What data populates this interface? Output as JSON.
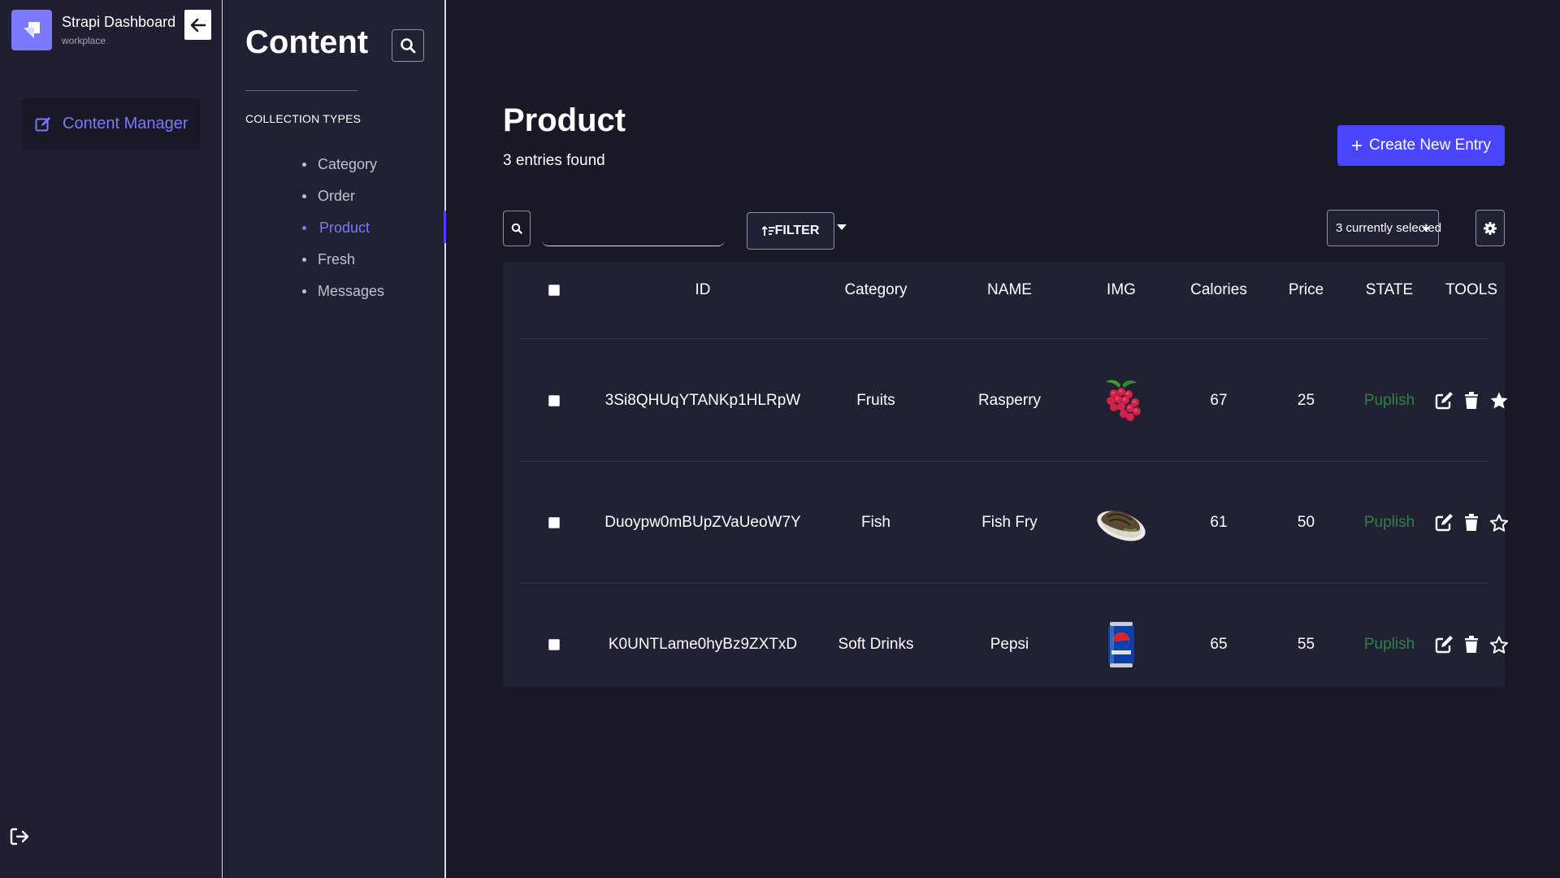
{
  "brand": {
    "title": "Strapi Dashboard",
    "subtitle": "workplace"
  },
  "leftnav": {
    "content_manager_label": "Content Manager"
  },
  "subnav": {
    "title": "Content",
    "section_title": "COLLECTION TYPES",
    "items": [
      {
        "label": "Category",
        "active": false
      },
      {
        "label": "Order",
        "active": false
      },
      {
        "label": "Product",
        "active": true
      },
      {
        "label": "Fresh",
        "active": false
      },
      {
        "label": "Messages",
        "active": false
      }
    ]
  },
  "main": {
    "title": "Product",
    "entries_text": "3 entries found",
    "create_button_label": "Create New Entry",
    "search_value": "",
    "filter_label": "FILTER",
    "columns_selected": "3 currently selected"
  },
  "table": {
    "headers": {
      "id": "ID",
      "category": "Category",
      "name": "NAME",
      "img": "IMG",
      "calories": "Calories",
      "price": "Price",
      "state": "STATE",
      "tools": "TOOLS"
    },
    "rows": [
      {
        "id": "3Si8QHUqYTANKp1HLRpW",
        "category": "Fruits",
        "name": "Rasperry",
        "img": "raspberry-image",
        "calories": "67",
        "price": "25",
        "state": "Puplish",
        "favorite": true
      },
      {
        "id": "Duoypw0mBUpZVaUeoW7Y",
        "category": "Fish",
        "name": "Fish Fry",
        "img": "fish-fry-image",
        "calories": "61",
        "price": "50",
        "state": "Puplish",
        "favorite": false
      },
      {
        "id": "K0UNTLame0hyBz9ZXTxD",
        "category": "Soft Drinks",
        "name": "Pepsi",
        "img": "pepsi-can-image",
        "calories": "65",
        "price": "55",
        "state": "Puplish",
        "favorite": false
      }
    ]
  },
  "colors": {
    "accent": "#4945ff",
    "accent_text": "#7b79ff",
    "state_published": "#328048",
    "background": "#181826",
    "panel": "#212134"
  },
  "icons": {
    "collapse": "arrow-left-icon",
    "content_manager": "edit-icon",
    "search": "search-icon",
    "filter": "sort-icon",
    "settings": "gear-icon",
    "logout": "logout-icon",
    "edit": "edit-icon",
    "delete": "trash-icon",
    "favorite": "star-icon"
  }
}
